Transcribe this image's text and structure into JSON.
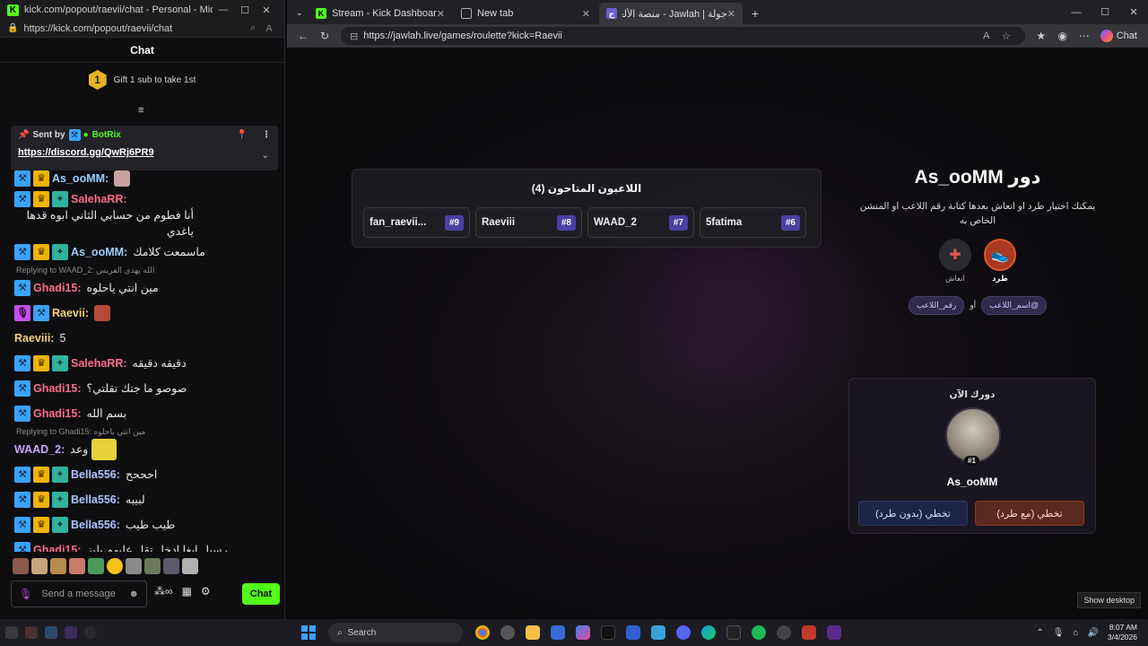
{
  "chat_window": {
    "title": "kick.com/popout/raevii/chat - Personal - Micros...",
    "url": "https://kick.com/popout/raevii/chat",
    "header": "Chat",
    "gift_rank": "1",
    "gift_text": "Gift 1 sub to take 1st",
    "pinned": {
      "sent_by": "Sent by",
      "bot_name": "BotRix",
      "link": "https://discord.gg/QwRj6PR9"
    },
    "messages": [
      {
        "user": "As_ooMM:",
        "text": "",
        "color": "#9bd1ff",
        "badges": [
          "mod",
          "crown"
        ]
      },
      {
        "user": "SalehaRR:",
        "text": "أنا فطوم من حسابي الثاني ابوه قدها ياغدي",
        "color": "#ff6b8a",
        "badges": [
          "mod",
          "crown",
          "sub"
        ]
      },
      {
        "user": "As_ooMM:",
        "text": "ماسمعت كلامك",
        "color": "#9bd1ff",
        "badges": [
          "mod",
          "crown",
          "sub"
        ]
      },
      {
        "reply": "Replying to WAAD_2: الله يهدي الفريس"
      },
      {
        "user": "Ghadi15:",
        "text": "مين انتي ياحلوه",
        "color": "#ff6b8a",
        "badges": [
          "mod"
        ]
      },
      {
        "user": "Raevii:",
        "text": "",
        "color": "#f4d06f",
        "badges": [
          "mic",
          "mod"
        ]
      },
      {
        "user": "Raeviii:",
        "text": "5",
        "color": "#f4d06f",
        "badges": []
      },
      {
        "user": "SalehaRR:",
        "text": "دقيقه دقيقه",
        "color": "#ff6b8a",
        "badges": [
          "mod",
          "crown",
          "sub"
        ]
      },
      {
        "user": "Ghadi15:",
        "text": "صوصو ما جتك تقلتي؟",
        "color": "#ff6b8a",
        "badges": [
          "mod"
        ]
      },
      {
        "user": "Ghadi15:",
        "text": "بسم الله",
        "color": "#ff6b8a",
        "badges": [
          "mod"
        ]
      },
      {
        "reply": "Replying to Ghadi15: مين انتي ياحلوه"
      },
      {
        "user": "WAAD_2:",
        "text": "وعد",
        "color": "#c6a3ff",
        "badges": []
      },
      {
        "user": "Bella556:",
        "text": "احححح",
        "color": "#a9c4ff",
        "badges": [
          "mod",
          "crown",
          "sub"
        ]
      },
      {
        "user": "Bella556:",
        "text": "لبيبه",
        "color": "#a9c4ff",
        "badges": [
          "mod",
          "crown",
          "sub"
        ]
      },
      {
        "user": "Bella556:",
        "text": "طيب طيب",
        "color": "#a9c4ff",
        "badges": [
          "mod",
          "crown",
          "sub"
        ]
      },
      {
        "user": "Ghadi15:",
        "text": "رسيل ابغا ادخل تقل عليهم بليز",
        "color": "#ff6b8a",
        "badges": [
          "mod"
        ]
      }
    ],
    "input_placeholder": "Send a message",
    "send_label": "Chat"
  },
  "browser": {
    "tabs": [
      {
        "title": "Stream - Kick Dashboard",
        "icon": "kick-icon",
        "active": false
      },
      {
        "title": "New tab",
        "icon": "newtab-icon",
        "active": false
      },
      {
        "title": "جولة | Jawlah - منصة الألعاب التفاعلية",
        "icon": "jawlah-icon",
        "active": true
      }
    ],
    "url": "https://jawlah.live/games/roulette?kick=Raevii",
    "chat_label": "Chat"
  },
  "game": {
    "players_title": "اللاعبون المتاحون (4)",
    "players": [
      {
        "num": "#6",
        "name": "5fatima"
      },
      {
        "num": "#7",
        "name": "WAAD_2"
      },
      {
        "num": "#8",
        "name": "Raeviii"
      },
      {
        "num": "#9",
        "name": "fan_raevii..."
      }
    ],
    "turn_title": "دور As_ooMM",
    "turn_desc": "يمكنك اختيار طرد او انعاش بعدها كتابة رقم اللاعب او المنشن الخاص به",
    "action_kick": "طرد",
    "action_revive": "انعاش",
    "hint_name": "@اسم_اللاعب",
    "hint_or": "أو",
    "hint_num": "رقم_اللاعب",
    "turn_card_head": "دورك الآن",
    "current_player_num": "#1",
    "current_player_name": "As_ooMM",
    "skip_with_kick": "تخطي (مع طرد)",
    "skip_without_kick": "تخطي (بدون طرد)",
    "show_desktop": "Show desktop"
  },
  "taskbar": {
    "search": "Search",
    "time": "8:07 AM",
    "date": "3/4/2026"
  }
}
